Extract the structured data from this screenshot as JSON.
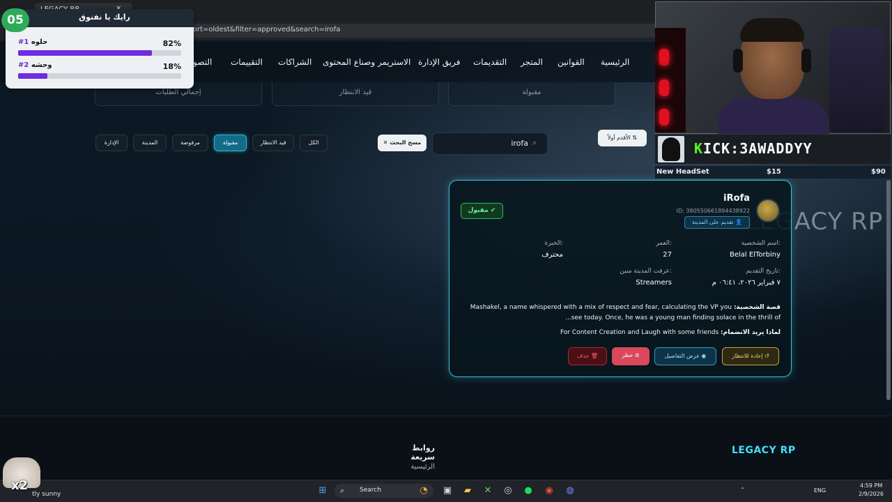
{
  "browser": {
    "tab_title": "LEGACY RP",
    "url": "...sort=oldest&filter=approved&search=irofa"
  },
  "nav": {
    "items": [
      "الرئيسية",
      "القوانين",
      "المتجر",
      "التقديمات",
      "فريق الإدارة",
      "الاستريمر وصناع المحتوى",
      "الشراكات",
      "التقييمات",
      "التصويت"
    ]
  },
  "stats": {
    "total": "إجمالي الطلبات",
    "pending": "قيد الانتظار",
    "approved": "مقبولة"
  },
  "filters": {
    "all": "الكل",
    "pending": "قيد الانتظار",
    "approved": "مقبولة",
    "rejected": "مرفوضة",
    "city": "المدينة",
    "admin": "الإدارة"
  },
  "search": {
    "value": "irofa",
    "clear_label": "مسح البحث",
    "sort_label": "الأقدم أولاً"
  },
  "application": {
    "status": "مقبول",
    "name": "iRofa",
    "id": "ID: 380550661894438922",
    "type": "تقديم على المدينة",
    "character_label": "اسم الشخصية:",
    "character_value": "Belal ElTorbiny",
    "age_label": "العمر:",
    "age_value": "27",
    "experience_label": "الخبرة:",
    "experience_value": "محترف",
    "date_label": "تاريخ التقديم:",
    "date_value": "٧ فبراير ٢٠٢٦، ٠٦:٤١ م",
    "source_label": "عرفت المدينة منين:",
    "source_value": "Streamers",
    "story_label": "قصة الشخصية:",
    "story_text": "Mashakel, a name whispered with a mix of respect and fear, calculating the VP you see today. Once, he was a young man finding solace in the thrill of...",
    "why_label": "لماذا يريد الانضمام:",
    "why_text": "For Content Creation and Laugh with some friends",
    "btn_reset": "إعادة للانتظار",
    "btn_details": "عرض التفاصيل",
    "btn_ban": "حظر",
    "btn_delete": "حذف"
  },
  "footer": {
    "logo": "LEGACY RP",
    "quick_links": "روابط سريعة",
    "home_link": "الرئيسية"
  },
  "poll": {
    "number": "05",
    "title": "رايك يا نفتوق",
    "options": [
      {
        "rank": "#1",
        "label": "حلوه",
        "percent": "82%",
        "fraction": 0.82
      },
      {
        "rank": "#2",
        "label": "وحشه",
        "percent": "18%",
        "fraction": 0.18
      }
    ]
  },
  "stream": {
    "kick_prefix": "K",
    "kick_text": "ICK:3AWADDYY",
    "goal_label": "New HeadSet",
    "goal_current": "$15",
    "goal_target": "$90",
    "background_logo": "LEGACY RP",
    "multiplier": "x2"
  },
  "taskbar": {
    "weather": "tly sunny",
    "search_label": "Search",
    "lang": "ENG",
    "time": "4:59 PM",
    "date": "2/9/2026"
  },
  "colors": {
    "accent": "#3ac6dd",
    "approved": "#2fc15a",
    "kick_green": "#53fc18",
    "poll_purple": "#6d2ee0"
  }
}
